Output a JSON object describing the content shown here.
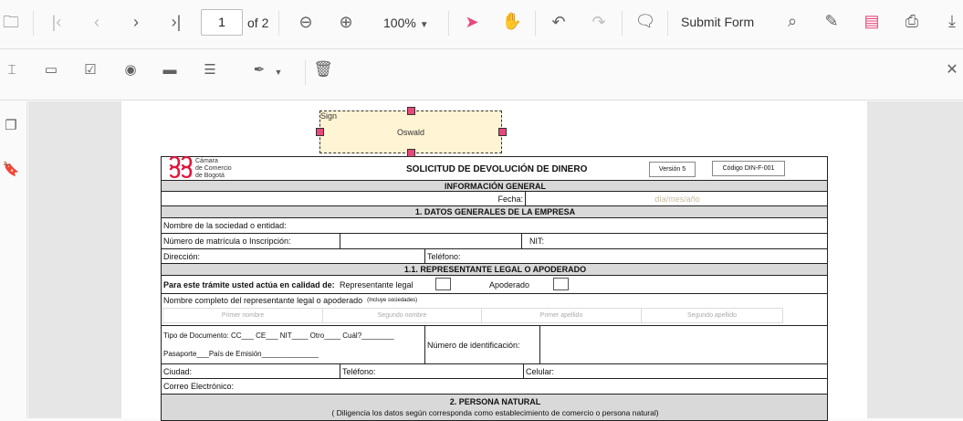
{
  "toolbar": {
    "page_current": "1",
    "page_total": "of 2",
    "zoom": "100%",
    "submit_form": "Submit Form"
  },
  "sign_field": {
    "label": "Sign",
    "value": "Oswald"
  },
  "form": {
    "logo_lines": [
      "Cámara",
      "de Comercio",
      "de Bogotá"
    ],
    "title": "SOLICITUD DE DEVOLUCIÓN DE DINERO",
    "version": "Versión 5",
    "code": "Código DIN-F-001",
    "info_general": "INFORMACIÓN GENERAL",
    "fecha_label": "Fecha:",
    "fecha_placeholder": "día/mes/año",
    "section1": "1.  DATOS GENERALES DE LA EMPRESA",
    "nombre_sociedad": "Nombre de la sociedad o entidad:",
    "matricula": "Número de matrícula o Inscripción:",
    "nit": "NIT:",
    "direccion": "Dirección:",
    "telefono": "Teléfono:",
    "section11": "1.1. REPRESENTANTE LEGAL O APODERADO",
    "calidad": "Para este trámite usted actúa en calidad de:",
    "rep_legal": "Representante legal",
    "apoderado": "Apoderado",
    "nombre_completo": "Nombre completo del representante legal o apoderado",
    "incluye": "(Incluye sociedades)",
    "name_fields": [
      "Primer nombre",
      "Segundo nombre",
      "Primer apellido",
      "Segundo apellido"
    ],
    "tipo_doc": "Tipo de Documento:  CC___ CE___ NIT____ Otro____ Cuál?________",
    "pasaporte": "Pasaporte___País de Emisión______________",
    "num_id": "Número de identificación:",
    "ciudad": "Ciudad:",
    "telefono2": "Teléfono:",
    "celular": "Celular:",
    "correo": "Correo Electrónico:",
    "section2": "2. PERSONA NATURAL",
    "section2_note": "( Diligencia los datos según corresponda como establecimiento de comercio o persona natural)"
  },
  "colors": {
    "accent": "#e8487a",
    "highlight": "#e00000"
  }
}
